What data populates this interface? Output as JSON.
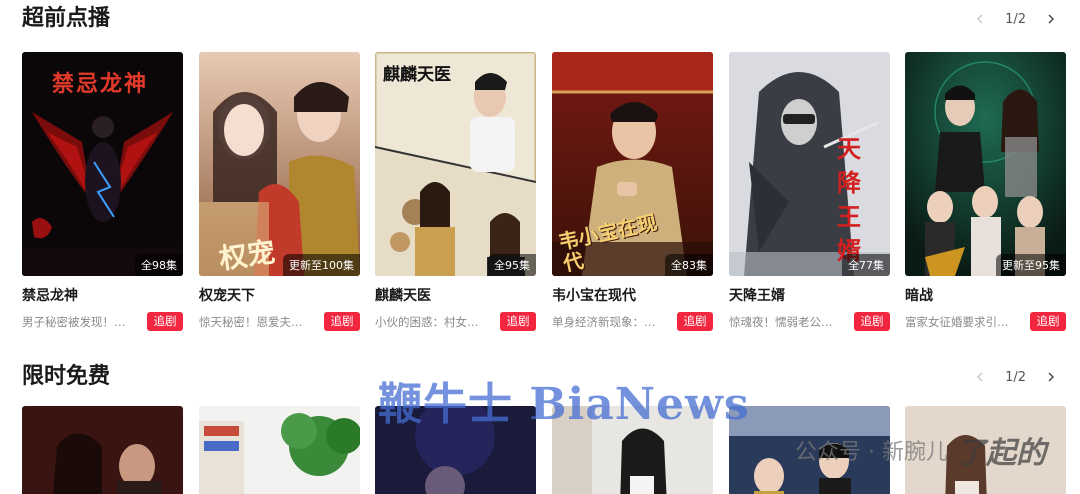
{
  "sections": [
    {
      "title": "超前点播",
      "page": "1/2",
      "cards": [
        {
          "title": "禁忌龙神",
          "desc": "男子秘密被发现！…",
          "badge": "全98集",
          "follow": "追剧",
          "poster_text": "禁忌龙神"
        },
        {
          "title": "权宠天下",
          "desc": "惊天秘密！恩爱夫…",
          "badge": "更新至100集",
          "follow": "追剧",
          "poster_text": "权宠"
        },
        {
          "title": "麒麟天医",
          "desc": "小伙的困惑：村女…",
          "badge": "全95集",
          "follow": "追剧",
          "poster_text": "麒麟天医"
        },
        {
          "title": "韦小宝在现代",
          "desc": "单身经济新现象：…",
          "badge": "全83集",
          "follow": "追剧",
          "poster_text": "韦小宝在现代"
        },
        {
          "title": "天降王婿",
          "desc": "惊魂夜！懦弱老公…",
          "badge": "全77集",
          "follow": "追剧",
          "poster_text": "天降王婿"
        },
        {
          "title": "暗战",
          "desc": "富家女征婚要求引…",
          "badge": "更新至95集",
          "follow": "追剧",
          "poster_text": ""
        }
      ]
    },
    {
      "title": "限时免费",
      "page": "1/2"
    }
  ],
  "watermark": "鞭牛士 BiaNews",
  "wechat_watermark": "公众号 · 新腕儿",
  "wechat_logo": "了起的",
  "colors": {
    "accent": "#f2263f"
  }
}
